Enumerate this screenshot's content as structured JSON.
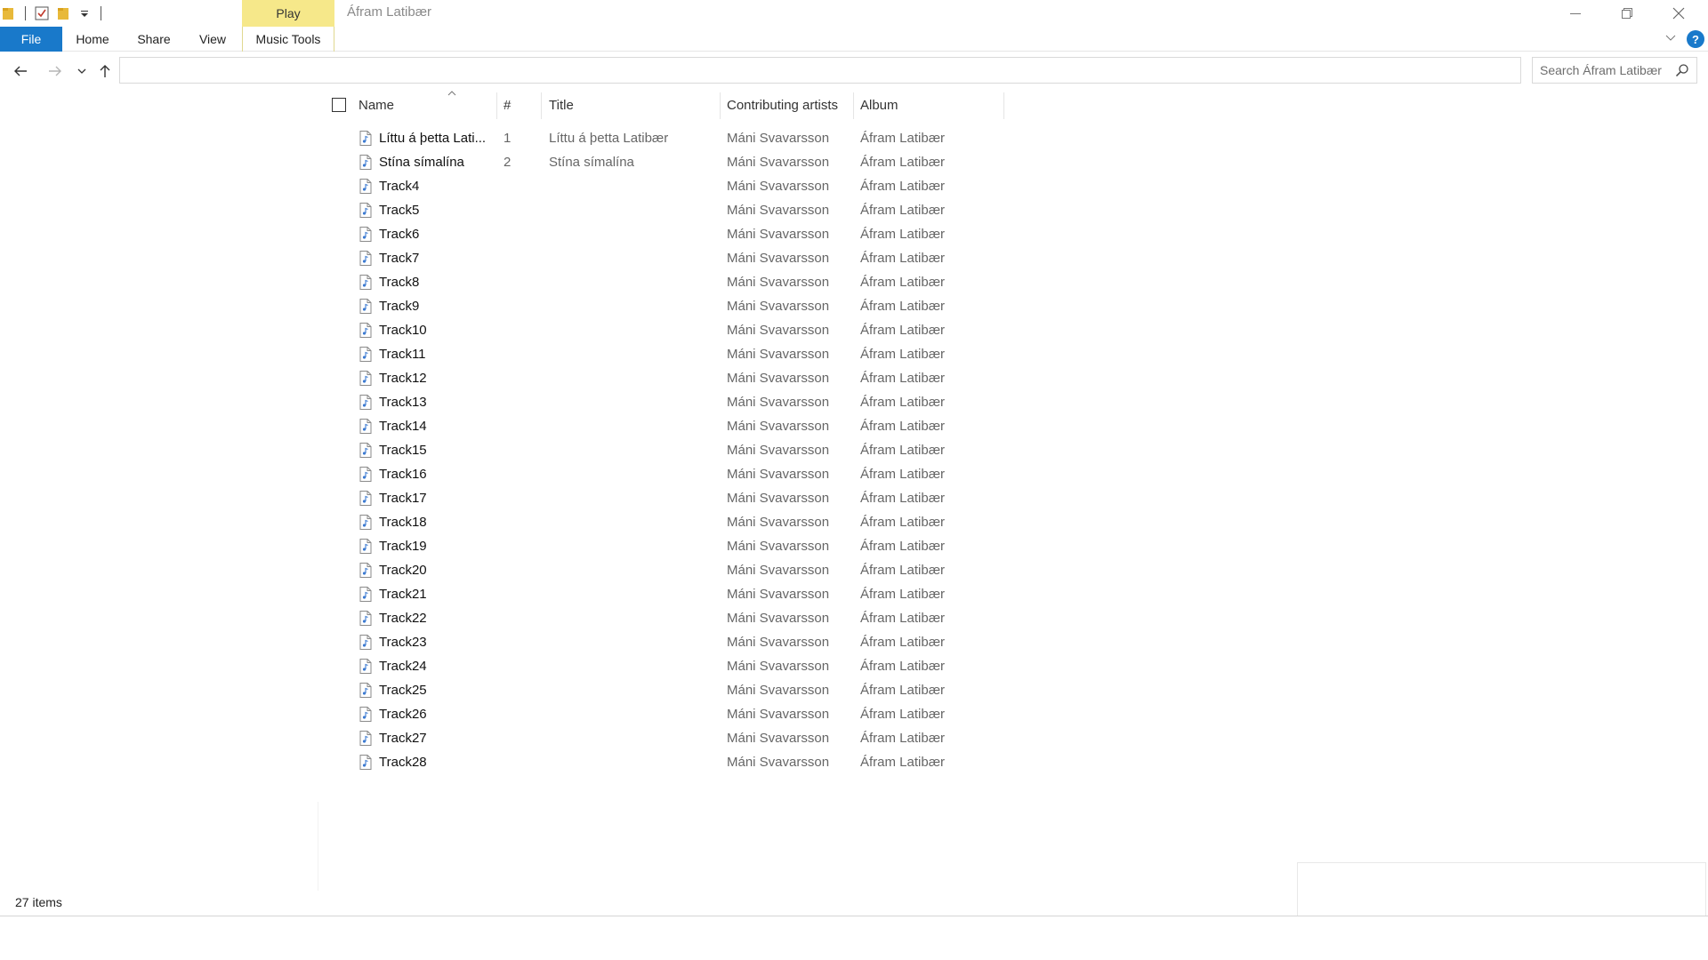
{
  "window": {
    "title": "Áfram Latibær",
    "context_tab": "Play"
  },
  "ribbon": {
    "tabs": [
      "File",
      "Home",
      "Share",
      "View",
      "Music Tools"
    ]
  },
  "search": {
    "placeholder": "Search Áfram Latibær"
  },
  "columns": {
    "name": "Name",
    "num": "#",
    "title": "Title",
    "artist": "Contributing artists",
    "album": "Album"
  },
  "files": [
    {
      "name": "Líttu á þetta Lati...",
      "num": "1",
      "title": "Líttu á þetta Latibær",
      "artist": "Máni Svavarsson",
      "album": "Áfram Latibær"
    },
    {
      "name": "Stína símalína",
      "num": "2",
      "title": "Stína símalína",
      "artist": "Máni Svavarsson",
      "album": "Áfram Latibær"
    },
    {
      "name": "Track4",
      "num": "",
      "title": "",
      "artist": "Máni Svavarsson",
      "album": "Áfram Latibær"
    },
    {
      "name": "Track5",
      "num": "",
      "title": "",
      "artist": "Máni Svavarsson",
      "album": "Áfram Latibær"
    },
    {
      "name": "Track6",
      "num": "",
      "title": "",
      "artist": "Máni Svavarsson",
      "album": "Áfram Latibær"
    },
    {
      "name": "Track7",
      "num": "",
      "title": "",
      "artist": "Máni Svavarsson",
      "album": "Áfram Latibær"
    },
    {
      "name": "Track8",
      "num": "",
      "title": "",
      "artist": "Máni Svavarsson",
      "album": "Áfram Latibær"
    },
    {
      "name": "Track9",
      "num": "",
      "title": "",
      "artist": "Máni Svavarsson",
      "album": "Áfram Latibær"
    },
    {
      "name": "Track10",
      "num": "",
      "title": "",
      "artist": "Máni Svavarsson",
      "album": "Áfram Latibær"
    },
    {
      "name": "Track11",
      "num": "",
      "title": "",
      "artist": "Máni Svavarsson",
      "album": "Áfram Latibær"
    },
    {
      "name": "Track12",
      "num": "",
      "title": "",
      "artist": "Máni Svavarsson",
      "album": "Áfram Latibær"
    },
    {
      "name": "Track13",
      "num": "",
      "title": "",
      "artist": "Máni Svavarsson",
      "album": "Áfram Latibær"
    },
    {
      "name": "Track14",
      "num": "",
      "title": "",
      "artist": "Máni Svavarsson",
      "album": "Áfram Latibær"
    },
    {
      "name": "Track15",
      "num": "",
      "title": "",
      "artist": "Máni Svavarsson",
      "album": "Áfram Latibær"
    },
    {
      "name": "Track16",
      "num": "",
      "title": "",
      "artist": "Máni Svavarsson",
      "album": "Áfram Latibær"
    },
    {
      "name": "Track17",
      "num": "",
      "title": "",
      "artist": "Máni Svavarsson",
      "album": "Áfram Latibær"
    },
    {
      "name": "Track18",
      "num": "",
      "title": "",
      "artist": "Máni Svavarsson",
      "album": "Áfram Latibær"
    },
    {
      "name": "Track19",
      "num": "",
      "title": "",
      "artist": "Máni Svavarsson",
      "album": "Áfram Latibær"
    },
    {
      "name": "Track20",
      "num": "",
      "title": "",
      "artist": "Máni Svavarsson",
      "album": "Áfram Latibær"
    },
    {
      "name": "Track21",
      "num": "",
      "title": "",
      "artist": "Máni Svavarsson",
      "album": "Áfram Latibær"
    },
    {
      "name": "Track22",
      "num": "",
      "title": "",
      "artist": "Máni Svavarsson",
      "album": "Áfram Latibær"
    },
    {
      "name": "Track23",
      "num": "",
      "title": "",
      "artist": "Máni Svavarsson",
      "album": "Áfram Latibær"
    },
    {
      "name": "Track24",
      "num": "",
      "title": "",
      "artist": "Máni Svavarsson",
      "album": "Áfram Latibær"
    },
    {
      "name": "Track25",
      "num": "",
      "title": "",
      "artist": "Máni Svavarsson",
      "album": "Áfram Latibær"
    },
    {
      "name": "Track26",
      "num": "",
      "title": "",
      "artist": "Máni Svavarsson",
      "album": "Áfram Latibær"
    },
    {
      "name": "Track27",
      "num": "",
      "title": "",
      "artist": "Máni Svavarsson",
      "album": "Áfram Latibær"
    },
    {
      "name": "Track28",
      "num": "",
      "title": "",
      "artist": "Máni Svavarsson",
      "album": "Áfram Latibær"
    }
  ],
  "status": {
    "items": "27 items"
  },
  "colors": {
    "file_tab": "#1979ca",
    "context_tab": "#f6e88a"
  }
}
